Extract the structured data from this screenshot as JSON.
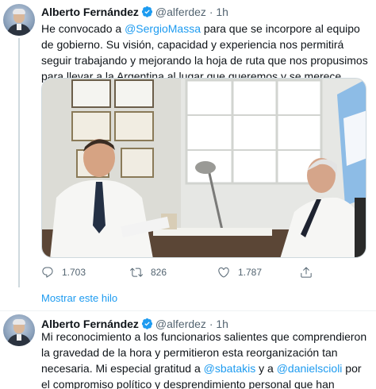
{
  "tweets": [
    {
      "author_name": "Alberto Fernández",
      "handle": "@alferdez",
      "separator": "·",
      "time": "1h",
      "text_parts": [
        "He convocado a ",
        "@SergioMassa",
        " para que se incorpore al equipo  de gobierno. Su visión, capacidad y experiencia nos permitirá seguir trabajando y mejorando la hoja de ruta que nos propusimos para llevar a la Argentina al lugar que queremos y se merece."
      ],
      "replies": "1.703",
      "retweets": "826",
      "likes": "1.787"
    },
    {
      "author_name": "Alberto Fernández",
      "handle": "@alferdez",
      "separator": "·",
      "time": "1h",
      "text_parts": [
        "Mi reconocimiento a los funcionarios salientes que comprendieron la gravedad de la hora y permitieron esta reorganización tan necesaria. Mi especial gratitud a ",
        "@sbatakis",
        " y a ",
        "@danielscioli",
        " por el compromiso político y desprendimiento personal que han demostrado."
      ]
    }
  ],
  "show_thread_label": "Mostrar este hilo",
  "icons": {
    "verified": "verified-badge-icon",
    "reply": "reply-icon",
    "retweet": "retweet-icon",
    "like": "heart-icon",
    "share": "share-icon"
  },
  "colors": {
    "accent": "#1d9bf0",
    "secondary_text": "#536471"
  }
}
